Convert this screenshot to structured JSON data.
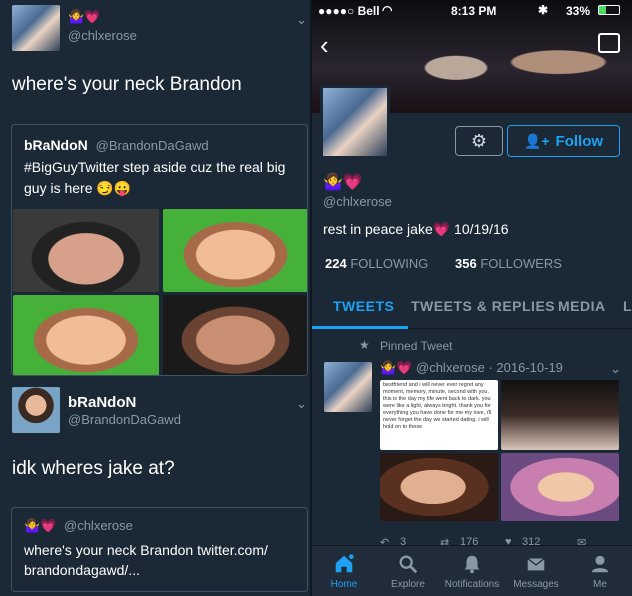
{
  "left": {
    "tweet1": {
      "emojis": "🤷‍♀️💗",
      "handle": "@chlxerose",
      "text": "where's your neck Brandon"
    },
    "quote1": {
      "name": "bRaNdoN",
      "handle": "@BrandonDaGawd",
      "text": "#BigGuyTwitter step aside cuz the real big guy is here 😏😛"
    },
    "tweet2": {
      "name": "bRaNdoN",
      "handle": "@BrandonDaGawd",
      "text": "idk wheres jake at?"
    },
    "quote2": {
      "emojis": "🤷‍♀️💗",
      "handle": "@chlxerose",
      "text": "where's your neck Brandon twitter.com/ brandondagawd/..."
    }
  },
  "right": {
    "status": {
      "carrier": "●●●●○ Bell",
      "time": "8:13 PM",
      "battery": "33%"
    },
    "profile": {
      "emojis": "🤷‍♀️💗",
      "handle": "@chlxerose",
      "bio": "rest in peace jake💗 10/19/16",
      "following_count": "224",
      "following_label": "FOLLOWING",
      "followers_count": "356",
      "followers_label": "FOLLOWERS",
      "follow_label": "Follow"
    },
    "tabs": [
      "TWEETS",
      "TWEETS & REPLIES",
      "MEDIA",
      "L"
    ],
    "pinned": {
      "label": "Pinned Tweet",
      "emojis": "🤷‍♀️💗",
      "handle": "@chlxerose",
      "date": "· 2016-10-19",
      "note_text": "bestfriend and i will never ever regret any moment, memory, minute, second with you. this is the day my life went back to dark. you were like a light, always bright. thank you for everything you have done for me my love, i'll never forget the day we started dating. i will hold on to these",
      "reply_count": "3",
      "retweet_count": "176",
      "like_count": "312"
    },
    "nav": [
      {
        "label": "Home",
        "icon": "home-icon"
      },
      {
        "label": "Explore",
        "icon": "search-icon"
      },
      {
        "label": "Notifications",
        "icon": "bell-icon"
      },
      {
        "label": "Messages",
        "icon": "envelope-icon"
      },
      {
        "label": "Me",
        "icon": "person-icon"
      }
    ]
  },
  "colors": {
    "background": "#1b2836",
    "accent": "#1da1f2",
    "muted": "#8899a6"
  }
}
